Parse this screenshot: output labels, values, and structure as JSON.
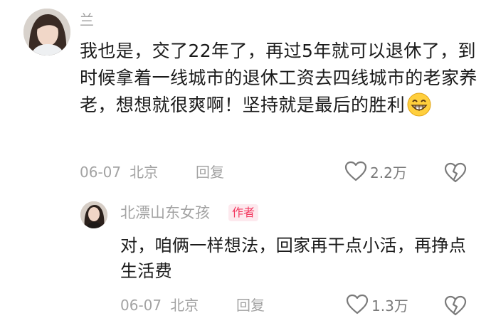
{
  "comment": {
    "username": "兰",
    "content": "我也是，交了22年了，再过5年就可以退休了，到时候拿着一线城市的退休工资去四线城市的老家养老，想想就很爽啊！坚持就是最后的胜利",
    "emoji": "grinning-face-emoji",
    "date": "06-07",
    "location": "北京",
    "reply_label": "回复",
    "likes": "2.2万"
  },
  "reply": {
    "username": "北漂山东女孩",
    "badge": "作者",
    "content": "对，咱俩一样想法，回家再干点小活，再挣点生活费",
    "date": "06-07",
    "location": "北京",
    "reply_label": "回复",
    "likes": "1.3万"
  },
  "colors": {
    "meta_gray": "#a3a3a3",
    "badge_bg": "#fde9ee",
    "badge_text": "#f3385f"
  }
}
